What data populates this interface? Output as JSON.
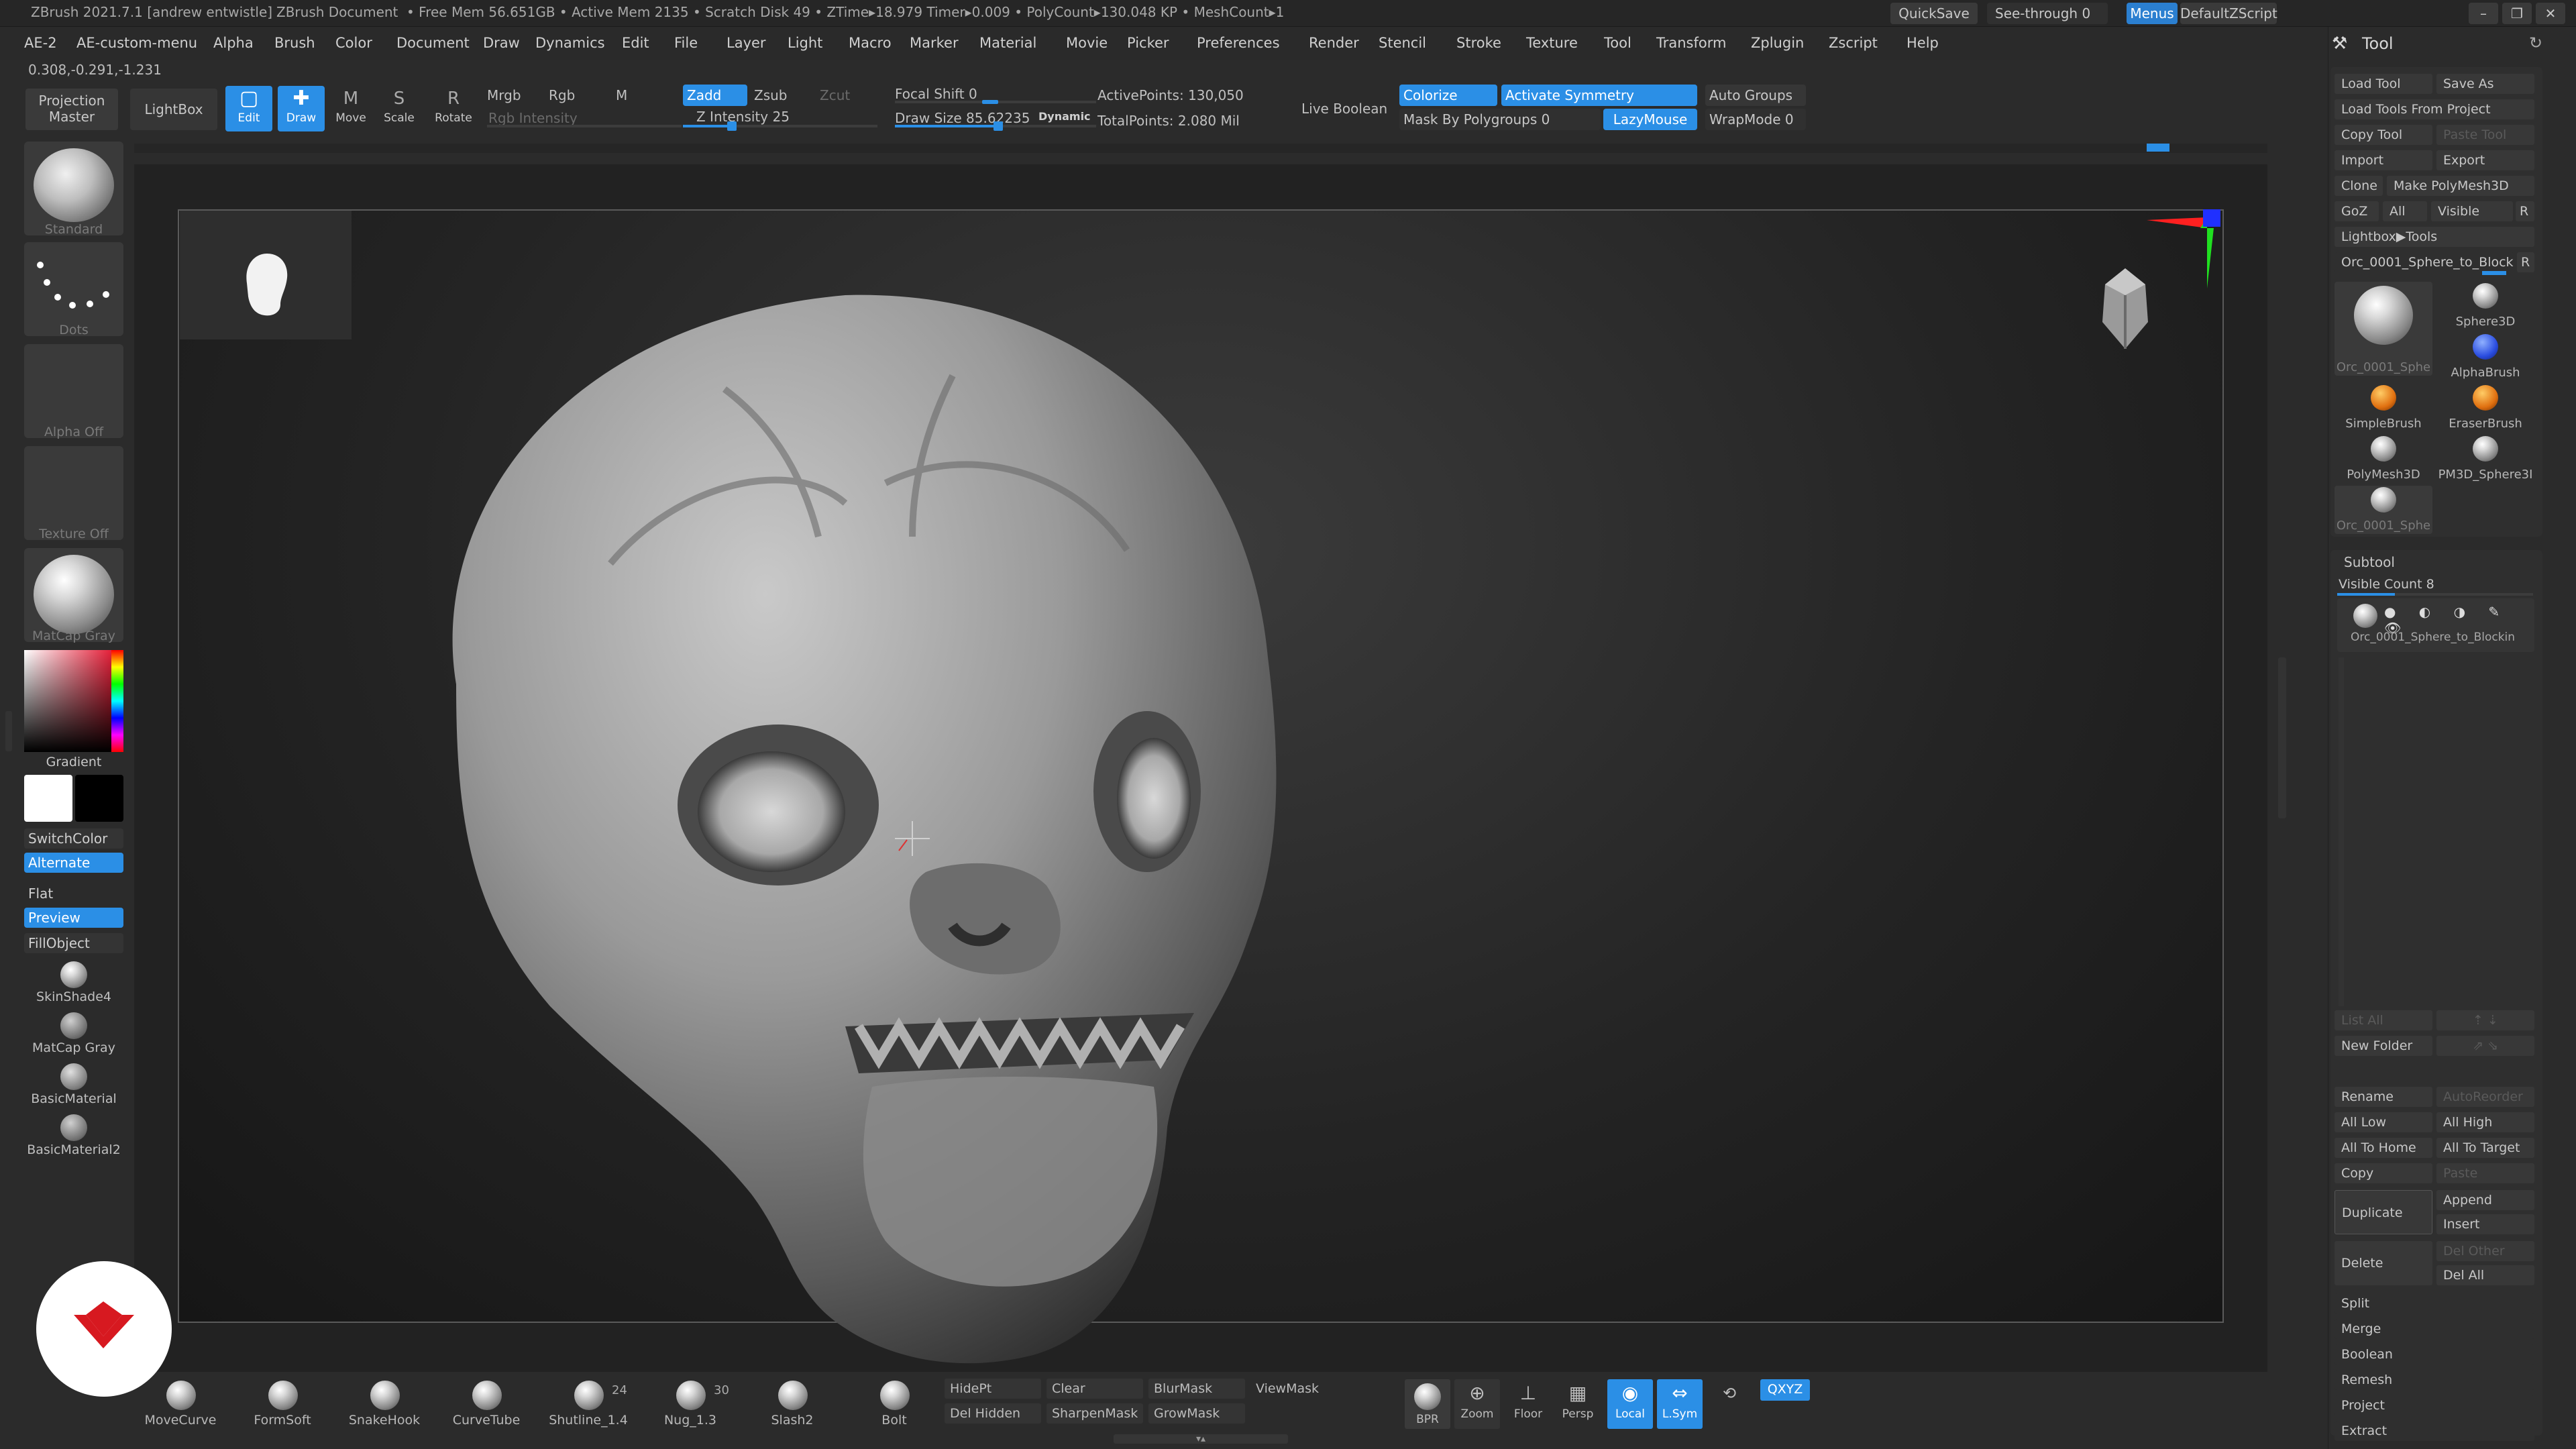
{
  "titlebar": {
    "app": "ZBrush 2021.7.1 [andrew entwistle]",
    "doc": "ZBrush Document",
    "stats": "• Free Mem 56.651GB • Active Mem 2135 • Scratch Disk 49 • ZTime▸18.979 Timer▸0.009 • PolyCount▸130.048 KP • MeshCount▸1",
    "quicksave": "QuickSave",
    "seethrough": "See-through 0",
    "menus": "Menus",
    "defaultzscript": "DefaultZScript"
  },
  "menubar": {
    "items": [
      "AE-2",
      "AE-custom-menu",
      "Alpha",
      "Brush",
      "Color",
      "Document",
      "Draw",
      "Dynamics",
      "Edit",
      "File",
      "Layer",
      "Light",
      "Macro",
      "Marker",
      "Material",
      "Movie",
      "Picker",
      "Preferences",
      "Render",
      "Stencil",
      "Stroke",
      "Texture",
      "Tool",
      "Transform",
      "Zplugin",
      "Zscript",
      "Help"
    ],
    "coords": "0.308,-0.291,-1.231"
  },
  "toolbar": {
    "projection_master": "Projection Master",
    "lightbox": "LightBox",
    "edit": "Edit",
    "draw": "Draw",
    "move": "Move",
    "scale": "Scale",
    "rotate": "Rotate",
    "mrgb": "Mrgb",
    "rgb": "Rgb",
    "m": "M",
    "rgb_intensity": "Rgb Intensity",
    "zadd": "Zadd",
    "zsub": "Zsub",
    "zcut": "Zcut",
    "z_intensity": "Z Intensity 25",
    "z_intensity_value": 25,
    "focal_shift": "Focal Shift 0",
    "draw_size": "Draw Size 85.62235",
    "draw_size_value": 85.62235,
    "dynamic": "Dynamic",
    "active_points": "ActivePoints: 130,050",
    "total_points": "TotalPoints: 2.080 Mil",
    "live_boolean": "Live Boolean",
    "colorize": "Colorize",
    "activate_symmetry": "Activate Symmetry",
    "auto_groups": "Auto Groups",
    "mask_by_polygroups": "Mask By Polygroups 0",
    "lazymouse": "LazyMouse",
    "wrapmode": "WrapMode 0"
  },
  "leftshelf": {
    "standard": "Standard",
    "dots": "Dots",
    "alpha_off": "Alpha Off",
    "texture_off": "Texture Off",
    "matcap_gray": "MatCap Gray",
    "gradient": "Gradient",
    "switchcolor": "SwitchColor",
    "alternate": "Alternate",
    "flat": "Flat",
    "preview": "Preview",
    "fillobject": "FillObject",
    "skinshade4": "SkinShade4",
    "matcap_gray2": "MatCap Gray",
    "basicmaterial": "BasicMaterial",
    "basicmaterial2": "BasicMaterial2"
  },
  "bottomshelf": {
    "brushes": [
      {
        "label": "MoveCurve"
      },
      {
        "label": "FormSoft"
      },
      {
        "label": "SnakeHook"
      },
      {
        "label": "CurveTube"
      },
      {
        "label": "Shutline_1.4",
        "count": "24"
      },
      {
        "label": "Nug_1.3",
        "count": "30"
      },
      {
        "label": "Slash2"
      },
      {
        "label": "Bolt"
      }
    ],
    "hidept": "HidePt",
    "delhidden": "Del Hidden",
    "clear": "Clear",
    "sharpenmask": "SharpenMask",
    "blurmask": "BlurMask",
    "growmask": "GrowMask",
    "viewmask": "ViewMask",
    "bpr": "BPR",
    "zoom": "Zoom",
    "floor": "Floor",
    "persp": "Persp",
    "local": "Local",
    "lsym": "L.Sym",
    "xyz": "QXYZ"
  },
  "tool_panel": {
    "title": "Tool",
    "load_tool": "Load Tool",
    "save_as": "Save As",
    "load_tools_from_project": "Load Tools From Project",
    "copy_tool": "Copy Tool",
    "paste_tool": "Paste Tool",
    "import": "Import",
    "export": "Export",
    "clone": "Clone",
    "make_polymesh3d": "Make PolyMesh3D",
    "goz": "GoZ",
    "all": "All",
    "visible": "Visible",
    "r": "R",
    "lightbox_tools": "Lightbox▶Tools",
    "current_tool": "Orc_0001_Sphere_to_Block",
    "tools": [
      {
        "label": "Orc_0001_Sphe"
      },
      {
        "label": "Sphere3D"
      },
      {
        "label": "AlphaBrush"
      },
      {
        "label": "SimpleBrush"
      },
      {
        "label": "EraserBrush"
      },
      {
        "label": "PolyMesh3D"
      },
      {
        "label": "PM3D_Sphere3I"
      },
      {
        "label": "Orc_0001_Sphe"
      }
    ]
  },
  "subtool_panel": {
    "title": "Subtool",
    "visible_count": "Visible Count 8",
    "subtool_name": "Orc_0001_Sphere_to_Blockin",
    "list_all": "List All",
    "new_folder": "New Folder",
    "rename": "Rename",
    "autoreorder": "AutoReorder",
    "all_low": "All Low",
    "all_high": "All High",
    "all_to_home": "All To Home",
    "all_to_target": "All To Target",
    "copy": "Copy",
    "paste": "Paste",
    "duplicate": "Duplicate",
    "append": "Append",
    "insert": "Insert",
    "delete": "Delete",
    "del_other": "Del Other",
    "del_all": "Del All",
    "split": "Split",
    "merge": "Merge",
    "boolean": "Boolean",
    "remesh": "Remesh",
    "project": "Project",
    "extract": "Extract"
  },
  "colors": {
    "accent": "#2b8fe6",
    "background": "#2b2b2b",
    "logo_red": "#d71920"
  }
}
